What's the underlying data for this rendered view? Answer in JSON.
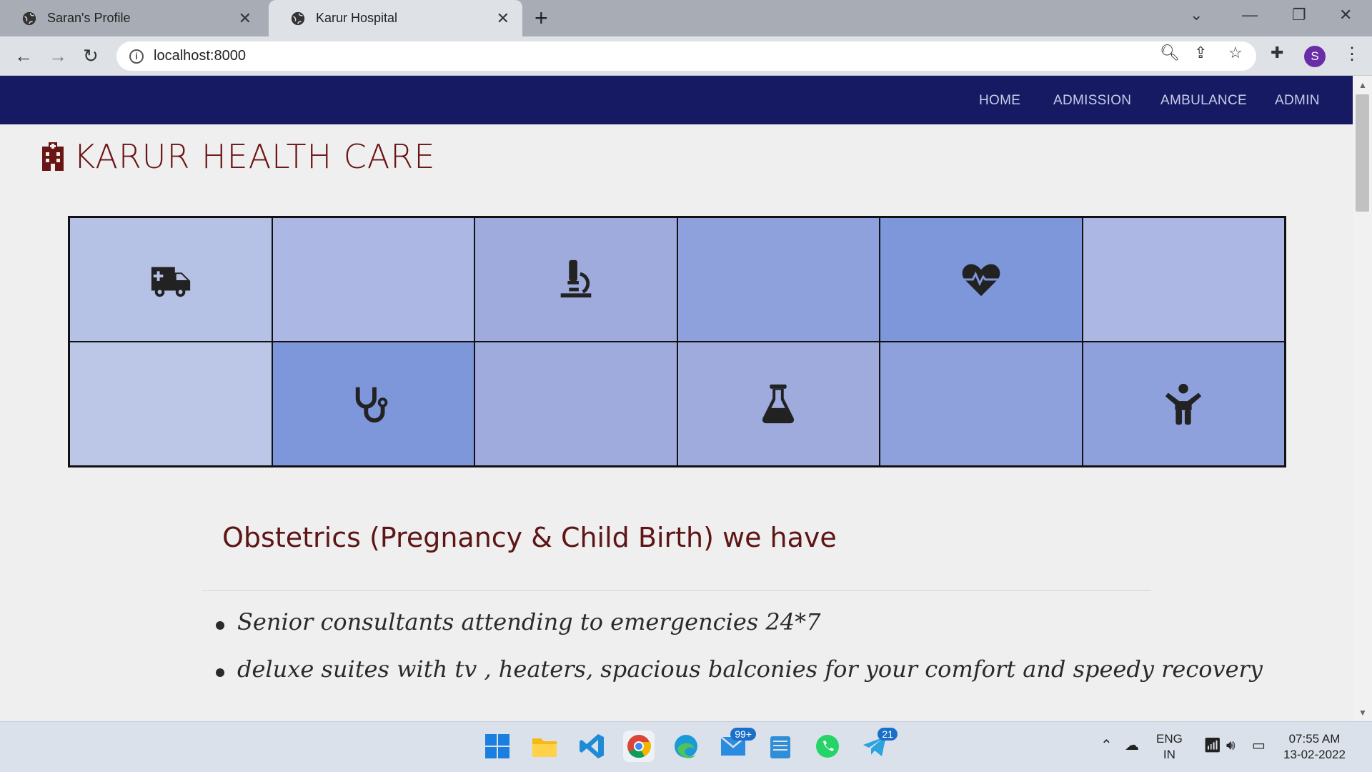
{
  "browser": {
    "tabs": [
      {
        "title": "Saran's Profile",
        "active": false
      },
      {
        "title": "Karur Hospital",
        "active": true
      }
    ],
    "url": "localhost:8000",
    "profile_initial": "S"
  },
  "site": {
    "nav": [
      "HOME",
      "ADMISSION",
      "AMBULANCE",
      "ADMIN"
    ],
    "brand": "KARUR HEALTH CARE",
    "grid_cells": [
      {
        "icon": "ambulance-icon",
        "color": "#b6c1e6"
      },
      {
        "icon": "",
        "color": "#adb7e3"
      },
      {
        "icon": "microscope-icon",
        "color": "#9faadd"
      },
      {
        "icon": "",
        "color": "#8fa1dd"
      },
      {
        "icon": "heartbeat-icon",
        "color": "#7e96da"
      },
      {
        "icon": "",
        "color": "#adb7e3"
      },
      {
        "icon": "",
        "color": "#bcc7e8"
      },
      {
        "icon": "stethoscope-icon",
        "color": "#7e96da"
      },
      {
        "icon": "",
        "color": "#9faadd"
      },
      {
        "icon": "flask-icon",
        "color": "#9faadd"
      },
      {
        "icon": "",
        "color": "#8fa1dd"
      },
      {
        "icon": "child-icon",
        "color": "#8fa1dd"
      }
    ],
    "heading": "Obstetrics (Pregnancy & Child Birth) we have",
    "features": [
      "Senior consultants attending to emergencies 24*7",
      "deluxe suites with tv , heaters, spacious balconies for your comfort and speedy recovery"
    ],
    "nav_bg": "#151a63",
    "brand_color": "#6a1414"
  },
  "taskbar": {
    "mail_badge": "99+",
    "telegram_badge": "21",
    "language": "ENG",
    "region": "IN",
    "time": "07:55 AM",
    "date": "13-02-2022"
  }
}
